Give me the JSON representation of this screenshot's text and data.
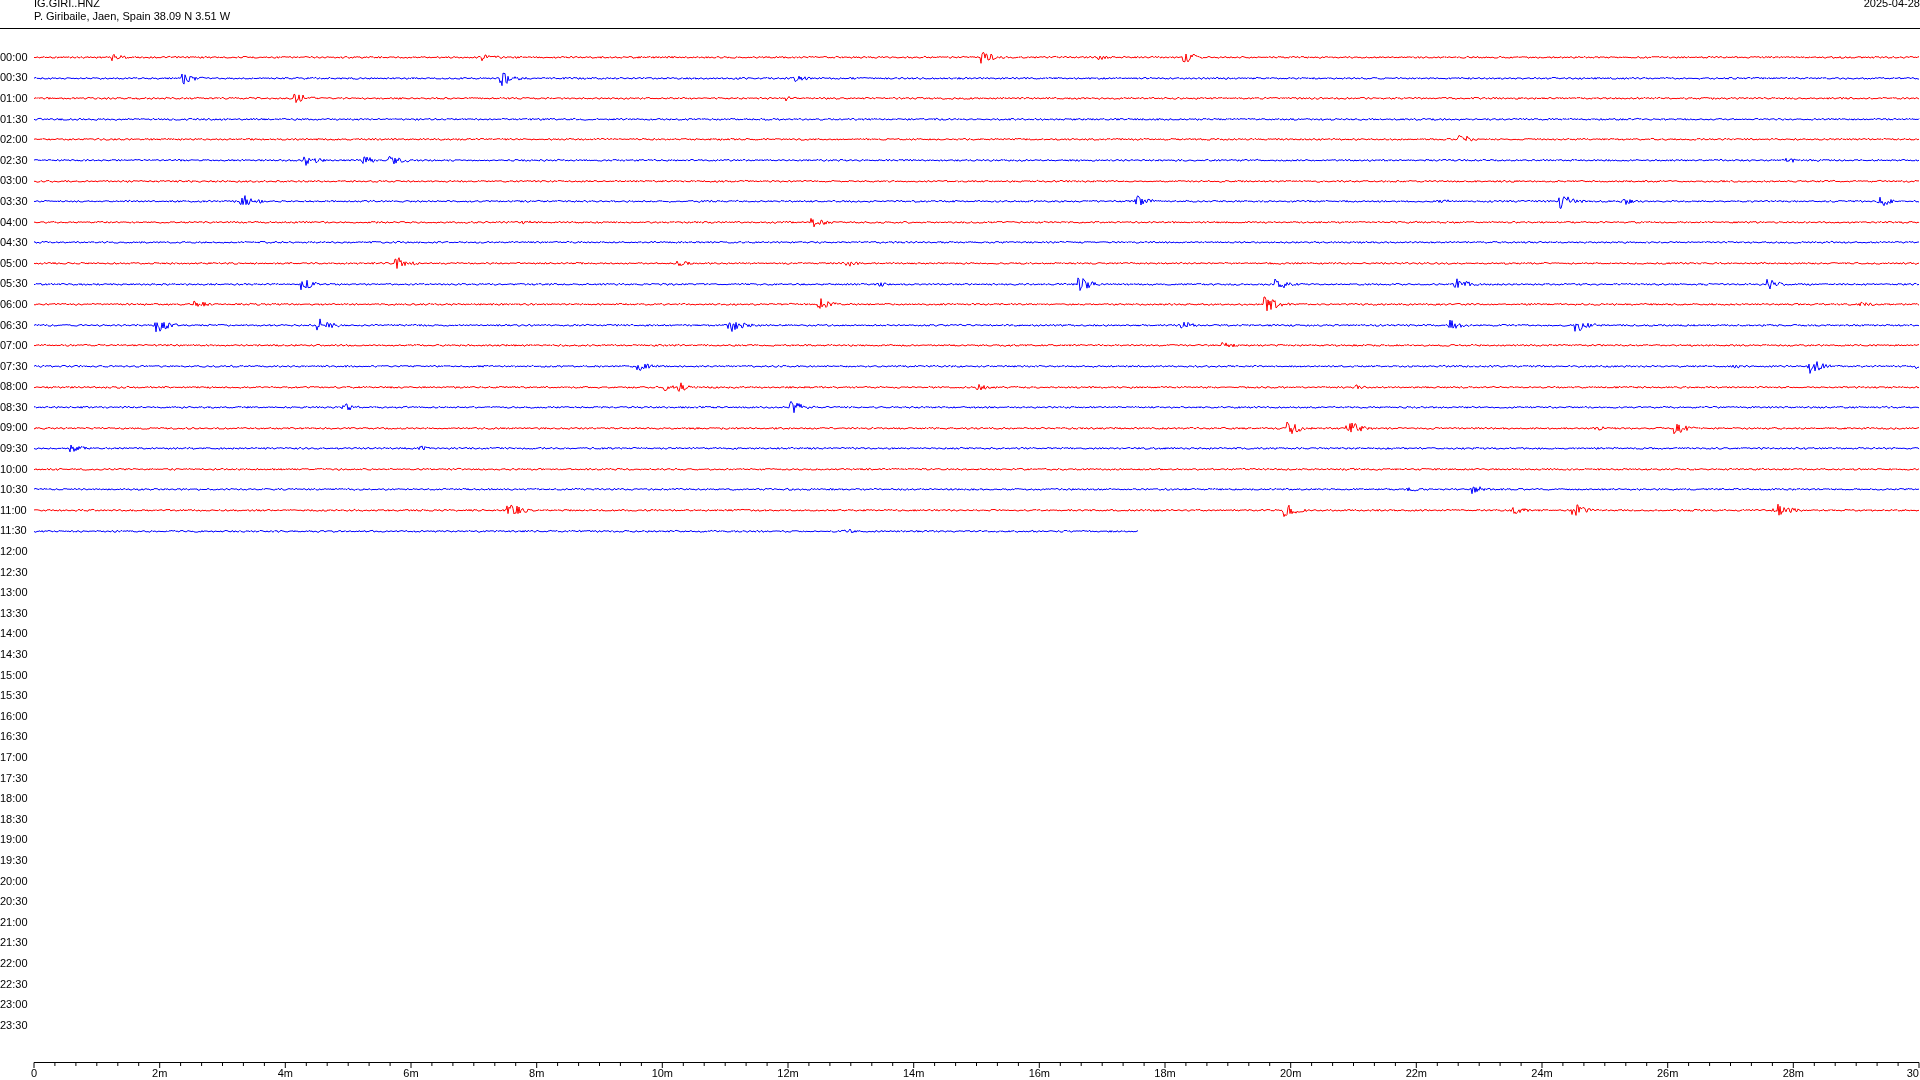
{
  "header": {
    "station": "IG.GIRI..HNZ",
    "location": "P. Giribaile, Jaen, Spain  38.09 N 3.51 W",
    "date": "2025-04-28"
  },
  "rows": [
    {
      "time": "00:00",
      "kind": "full",
      "color": "#ff0000"
    },
    {
      "time": "00:30",
      "kind": "full",
      "color": "#0000ff"
    },
    {
      "time": "01:00",
      "kind": "full",
      "color": "#ff0000"
    },
    {
      "time": "01:30",
      "kind": "full",
      "color": "#0000ff"
    },
    {
      "time": "02:00",
      "kind": "full",
      "color": "#ff0000"
    },
    {
      "time": "02:30",
      "kind": "full",
      "color": "#0000ff"
    },
    {
      "time": "03:00",
      "kind": "full",
      "color": "#ff0000"
    },
    {
      "time": "03:30",
      "kind": "full",
      "color": "#0000ff"
    },
    {
      "time": "04:00",
      "kind": "full",
      "color": "#ff0000"
    },
    {
      "time": "04:30",
      "kind": "full",
      "color": "#0000ff"
    },
    {
      "time": "05:00",
      "kind": "full",
      "color": "#ff0000"
    },
    {
      "time": "05:30",
      "kind": "full",
      "color": "#0000ff"
    },
    {
      "time": "06:00",
      "kind": "full",
      "color": "#ff0000"
    },
    {
      "time": "06:30",
      "kind": "full",
      "color": "#0000ff"
    },
    {
      "time": "07:00",
      "kind": "full",
      "color": "#ff0000"
    },
    {
      "time": "07:30",
      "kind": "full",
      "color": "#0000ff"
    },
    {
      "time": "08:00",
      "kind": "full",
      "color": "#ff0000"
    },
    {
      "time": "08:30",
      "kind": "full",
      "color": "#0000ff"
    },
    {
      "time": "09:00",
      "kind": "full",
      "color": "#ff0000"
    },
    {
      "time": "09:30",
      "kind": "full",
      "color": "#0000ff"
    },
    {
      "time": "10:00",
      "kind": "full",
      "color": "#ff0000"
    },
    {
      "time": "10:30",
      "kind": "full",
      "color": "#0000ff"
    },
    {
      "time": "11:00",
      "kind": "full",
      "color": "#ff0000"
    },
    {
      "time": "11:30",
      "kind": "partial",
      "color": "#0000ff"
    },
    {
      "time": "12:00",
      "kind": "empty"
    },
    {
      "time": "12:30",
      "kind": "empty"
    },
    {
      "time": "13:00",
      "kind": "empty"
    },
    {
      "time": "13:30",
      "kind": "empty"
    },
    {
      "time": "14:00",
      "kind": "empty"
    },
    {
      "time": "14:30",
      "kind": "empty"
    },
    {
      "time": "15:00",
      "kind": "empty"
    },
    {
      "time": "15:30",
      "kind": "empty"
    },
    {
      "time": "16:00",
      "kind": "empty"
    },
    {
      "time": "16:30",
      "kind": "empty"
    },
    {
      "time": "17:00",
      "kind": "empty"
    },
    {
      "time": "17:30",
      "kind": "empty"
    },
    {
      "time": "18:00",
      "kind": "empty"
    },
    {
      "time": "18:30",
      "kind": "empty"
    },
    {
      "time": "19:00",
      "kind": "empty"
    },
    {
      "time": "19:30",
      "kind": "empty"
    },
    {
      "time": "20:00",
      "kind": "empty"
    },
    {
      "time": "20:30",
      "kind": "empty"
    },
    {
      "time": "21:00",
      "kind": "empty"
    },
    {
      "time": "21:30",
      "kind": "empty"
    },
    {
      "time": "22:00",
      "kind": "empty"
    },
    {
      "time": "22:30",
      "kind": "empty"
    },
    {
      "time": "23:00",
      "kind": "empty"
    },
    {
      "time": "23:30",
      "kind": "empty"
    }
  ],
  "x_axis": {
    "labels": [
      "0",
      "2m",
      "4m",
      "6m",
      "8m",
      "10m",
      "12m",
      "14m",
      "16m",
      "18m",
      "20m",
      "22m",
      "24m",
      "26m",
      "28m",
      "30"
    ]
  }
}
